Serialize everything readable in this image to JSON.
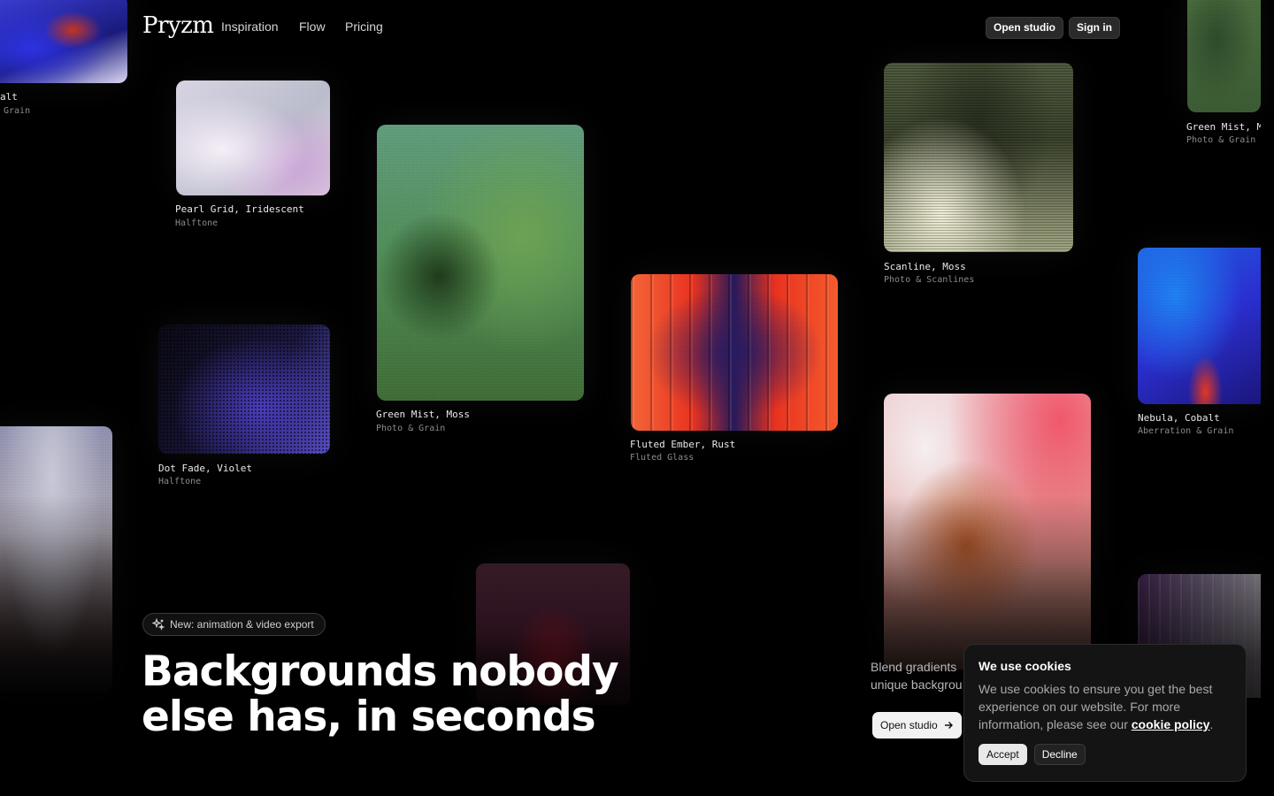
{
  "nav": {
    "logo": "Pryzm",
    "links": [
      "Inspiration",
      "Flow",
      "Pricing"
    ],
    "open_studio": "Open studio",
    "sign_in": "Sign in"
  },
  "gallery": [
    {
      "title": "alt",
      "subtitle": "Grain"
    },
    {
      "title": "Pearl Grid, Iridescent",
      "subtitle": "Halftone"
    },
    {
      "title": "Green Mist, Moss",
      "subtitle": "Photo & Grain"
    },
    {
      "title": "Fluted Ember, Rust",
      "subtitle": "Fluted Glass"
    },
    {
      "title": "Scanline, Moss",
      "subtitle": "Photo & Scanlines"
    },
    {
      "title": "Green Mist, Mo",
      "subtitle": "Photo & Grain"
    },
    {
      "title": "Nebula, Cobalt",
      "subtitle": "Aberration & Grain"
    },
    {
      "title": "Dot Fade, Violet",
      "subtitle": "Halftone"
    }
  ],
  "hero": {
    "badge": "New: animation & video export",
    "headline_line1": "Backgrounds nobody",
    "headline_line2": "else has, in seconds",
    "blend_line1": "Blend gradients",
    "blend_line2": "unique backgrou",
    "cta": "Open studio"
  },
  "cookie": {
    "title": "We use cookies",
    "body": "We use cookies to ensure you get the best experience on our website. For more information, please see our ",
    "link": "cookie policy",
    "period": ".",
    "accept": "Accept",
    "decline": "Decline"
  },
  "colors": {
    "background": "#000000",
    "text": "#ffffff",
    "muted": "#8b8b8b"
  }
}
